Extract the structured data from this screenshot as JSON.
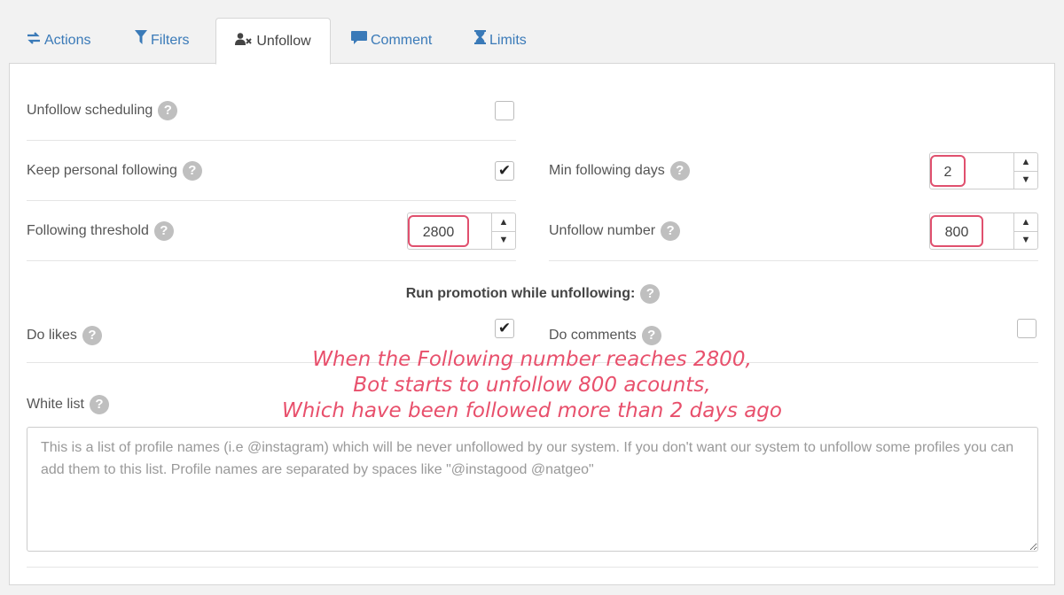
{
  "tabs": [
    {
      "label": "Actions",
      "icon": "exchange-arrows-icon"
    },
    {
      "label": "Filters",
      "icon": "funnel-icon"
    },
    {
      "label": "Unfollow",
      "icon": "user-x-icon",
      "active": true
    },
    {
      "label": "Comment",
      "icon": "speech-bubble-icon"
    },
    {
      "label": "Limits",
      "icon": "hourglass-icon"
    }
  ],
  "help_glyph": "?",
  "settings": {
    "unfollow_scheduling": {
      "label": "Unfollow scheduling",
      "checked": false
    },
    "keep_personal_following": {
      "label": "Keep personal following",
      "checked": true
    },
    "min_following_days": {
      "label": "Min following days",
      "value": "2"
    },
    "following_threshold": {
      "label": "Following threshold",
      "value": "2800"
    },
    "unfollow_number": {
      "label": "Unfollow number",
      "value": "800"
    }
  },
  "promotion": {
    "title": "Run promotion while unfollowing:",
    "do_likes": {
      "label": "Do likes",
      "checked": true
    },
    "do_comments": {
      "label": "Do comments",
      "checked": false
    }
  },
  "white_list": {
    "label": "White list",
    "placeholder": "This is a list of profile names (i.e @instagram) which will be never unfollowed by our system. If you don't want our system to unfollow some profiles you can add them to this list. Profile names are separated by spaces like \"@instagood @natgeo\""
  },
  "annotation": {
    "line1": "When the Following number reaches 2800,",
    "line2": "Bot starts to unfollow 800 acounts,",
    "line3": "Which have been followed more than 2 days ago"
  },
  "glyphs": {
    "check": "✔",
    "up": "▲",
    "down": "▼"
  },
  "colors": {
    "link": "#3a7ab8",
    "highlight": "#e0506e",
    "annotation": "#e8506c"
  }
}
